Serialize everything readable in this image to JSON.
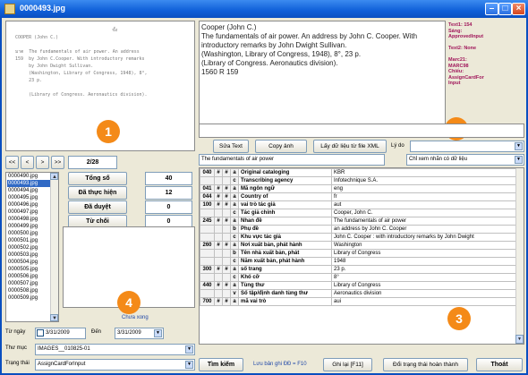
{
  "window": {
    "title": "0000493.jpg"
  },
  "badges": [
    "1",
    "2",
    "3",
    "4"
  ],
  "scan_text": "                                      ขั้ง\n  COOPER (John C.)\n\n  มาต  The fundamentals of air power. An address\n  159  by John C.Cooper. With introductory remarks\n       by John Dwight Sullivan.\n       (Washington, Library of Congress, 1948), 8°,\n       23 p.\n\n       (Library of Congress. Aeronautics division).",
  "record_text": "Cooper (John C.)\nThe fundamentals of air power. An address by John C. Cooper. With\nintroductory remarks by John Dwight Sullivan.\n(Washington, Library of Congress, 1948), 8°, 23 p.\n(Library of Congress. Aeronautics division).\n1560 R 159",
  "meta_text": "Text1: 154\nSáng:\nApprovedInput\n\nText2: None\n\nMarc21:\nMARC98\nChiếu:\nAssignCardFor\nInput",
  "buttons": {
    "fix_text": "Sửa Text",
    "copy_image": "Copy ảnh",
    "xml": "Lấy dữ liệu từ file XML",
    "reason_label": "Lý do",
    "search": "Tìm kiếm",
    "save_note": "Lưu bản ghi ĐĐ = F10",
    "save": "Ghi lại [F11]",
    "mark_done": "Đổi trạng thái hoàn thành",
    "exit": "Thoát"
  },
  "nav": {
    "first": "<<",
    "prev": "<",
    "next": ">",
    "last": ">>",
    "counter": "2/28"
  },
  "title_field": "The fundamentals of air power",
  "filter_option": "Chỉ xem nhãn có dữ liệu",
  "stats": [
    {
      "label": "Tổng số",
      "value": "40"
    },
    {
      "label": "Đã thực hiện",
      "value": "12"
    },
    {
      "label": "Đã duyệt",
      "value": "0"
    },
    {
      "label": "Từ chối",
      "value": "0"
    }
  ],
  "status_text": "Chưa xong",
  "files": [
    "0000490.jpg",
    "0000493.jpg",
    "0000494.jpg",
    "0000495.jpg",
    "0000496.jpg",
    "0000497.jpg",
    "0000498.jpg",
    "0000499.jpg",
    "0000500.jpg",
    "0000501.jpg",
    "0000502.jpg",
    "0000503.jpg",
    "0000504.jpg",
    "0000505.jpg",
    "0000506.jpg",
    "0000507.jpg",
    "0000508.jpg",
    "0000509.jpg"
  ],
  "selected_file_index": 1,
  "filters": {
    "from_label": "Từ ngày",
    "from_value": "3/31/2009",
    "to_label": "Đến",
    "to_value": "3/31/2009",
    "folder_label": "Thư mục",
    "folder_value": "IMAGES__010825-01",
    "state_label": "Trạng thái",
    "state_value": "AssignCardForInput"
  },
  "marc_rows": [
    {
      "tag": "040",
      "i1": "#",
      "i2": "#",
      "sub": "a",
      "field": "Original cataloging",
      "value": "KBR"
    },
    {
      "tag": "",
      "i1": "",
      "i2": "",
      "sub": "c",
      "field": "Transcribing agency",
      "value": "Infotechnique S.A."
    },
    {
      "tag": "041",
      "i1": "#",
      "i2": "#",
      "sub": "a",
      "field": "Mã ngôn ngữ",
      "value": "eng"
    },
    {
      "tag": "044",
      "i1": "#",
      "i2": "#",
      "sub": "a",
      "field": "Country of",
      "value": "fr"
    },
    {
      "tag": "100",
      "i1": "#",
      "i2": "#",
      "sub": "a",
      "field": "vai trò tác giả",
      "value": "aut"
    },
    {
      "tag": "",
      "i1": "",
      "i2": "",
      "sub": "c",
      "field": "Tác giả chính",
      "value": "Cooper, John C."
    },
    {
      "tag": "245",
      "i1": "#",
      "i2": "#",
      "sub": "a",
      "field": "Nhan đề",
      "value": "The fundamentals of air power"
    },
    {
      "tag": "",
      "i1": "",
      "i2": "",
      "sub": "b",
      "field": "Phụ đề",
      "value": "an address by John C. Cooper"
    },
    {
      "tag": "",
      "i1": "",
      "i2": "",
      "sub": "c",
      "field": "Khu vực tác giả",
      "value": "John C. Cooper : with introductory remarks by John Dwight"
    },
    {
      "tag": "260",
      "i1": "#",
      "i2": "#",
      "sub": "a",
      "field": "Nơi xuất bản, phát hành",
      "value": "Washington"
    },
    {
      "tag": "",
      "i1": "",
      "i2": "",
      "sub": "b",
      "field": "Tên nhà xuất bản, phát",
      "value": "Library of Congress"
    },
    {
      "tag": "",
      "i1": "",
      "i2": "",
      "sub": "c",
      "field": "Năm xuất bản, phát hành",
      "value": "1948"
    },
    {
      "tag": "300",
      "i1": "#",
      "i2": "#",
      "sub": "a",
      "field": "số trang",
      "value": "23 p."
    },
    {
      "tag": "",
      "i1": "",
      "i2": "",
      "sub": "c",
      "field": "Khổ cỡ",
      "value": "8°"
    },
    {
      "tag": "440",
      "i1": "#",
      "i2": "#",
      "sub": "a",
      "field": "Tùng thư",
      "value": "Library of Congress"
    },
    {
      "tag": "",
      "i1": "",
      "i2": "",
      "sub": "v",
      "field": "Số tập/định danh tùng thư",
      "value": "Aeronautics division"
    },
    {
      "tag": "700",
      "i1": "#",
      "i2": "#",
      "sub": "a",
      "field": "mã vai trò",
      "value": "aui"
    }
  ]
}
